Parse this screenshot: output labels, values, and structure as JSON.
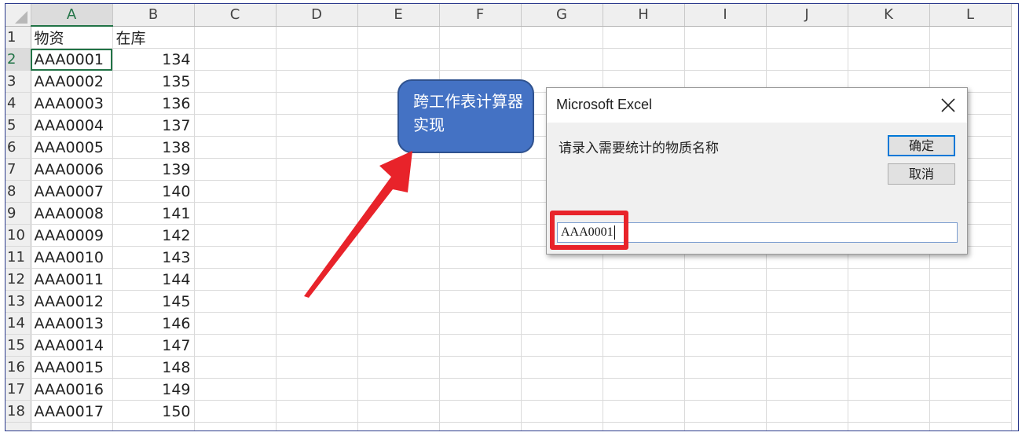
{
  "sheet": {
    "columns": [
      "A",
      "B",
      "C",
      "D",
      "E",
      "F",
      "G",
      "H",
      "I",
      "J",
      "K",
      "L"
    ],
    "rows": [
      {
        "num": "1",
        "a": "物资",
        "b": "在库"
      },
      {
        "num": "2",
        "a": "AAA0001",
        "b": "134"
      },
      {
        "num": "3",
        "a": "AAA0002",
        "b": "135"
      },
      {
        "num": "4",
        "a": "AAA0003",
        "b": "136"
      },
      {
        "num": "5",
        "a": "AAA0004",
        "b": "137"
      },
      {
        "num": "6",
        "a": "AAA0005",
        "b": "138"
      },
      {
        "num": "7",
        "a": "AAA0006",
        "b": "139"
      },
      {
        "num": "8",
        "a": "AAA0007",
        "b": "140"
      },
      {
        "num": "9",
        "a": "AAA0008",
        "b": "141"
      },
      {
        "num": "10",
        "a": "AAA0009",
        "b": "142"
      },
      {
        "num": "11",
        "a": "AAA0010",
        "b": "143"
      },
      {
        "num": "12",
        "a": "AAA0011",
        "b": "144"
      },
      {
        "num": "13",
        "a": "AAA0012",
        "b": "145"
      },
      {
        "num": "14",
        "a": "AAA0013",
        "b": "146"
      },
      {
        "num": "15",
        "a": "AAA0014",
        "b": "147"
      },
      {
        "num": "16",
        "a": "AAA0015",
        "b": "148"
      },
      {
        "num": "17",
        "a": "AAA0016",
        "b": "149"
      },
      {
        "num": "18",
        "a": "AAA0017",
        "b": "150"
      }
    ],
    "selected_column": "A",
    "selected_row": "2"
  },
  "callout": {
    "text": "跨工作表计算器实现",
    "fill": "#4472c4"
  },
  "dialog": {
    "title": "Microsoft Excel",
    "prompt": "请录入需要统计的物质名称",
    "ok_label": "确定",
    "cancel_label": "取消",
    "input_value": "AAA0001",
    "close_icon": "close-icon"
  },
  "annotation_color": "#e8232a"
}
